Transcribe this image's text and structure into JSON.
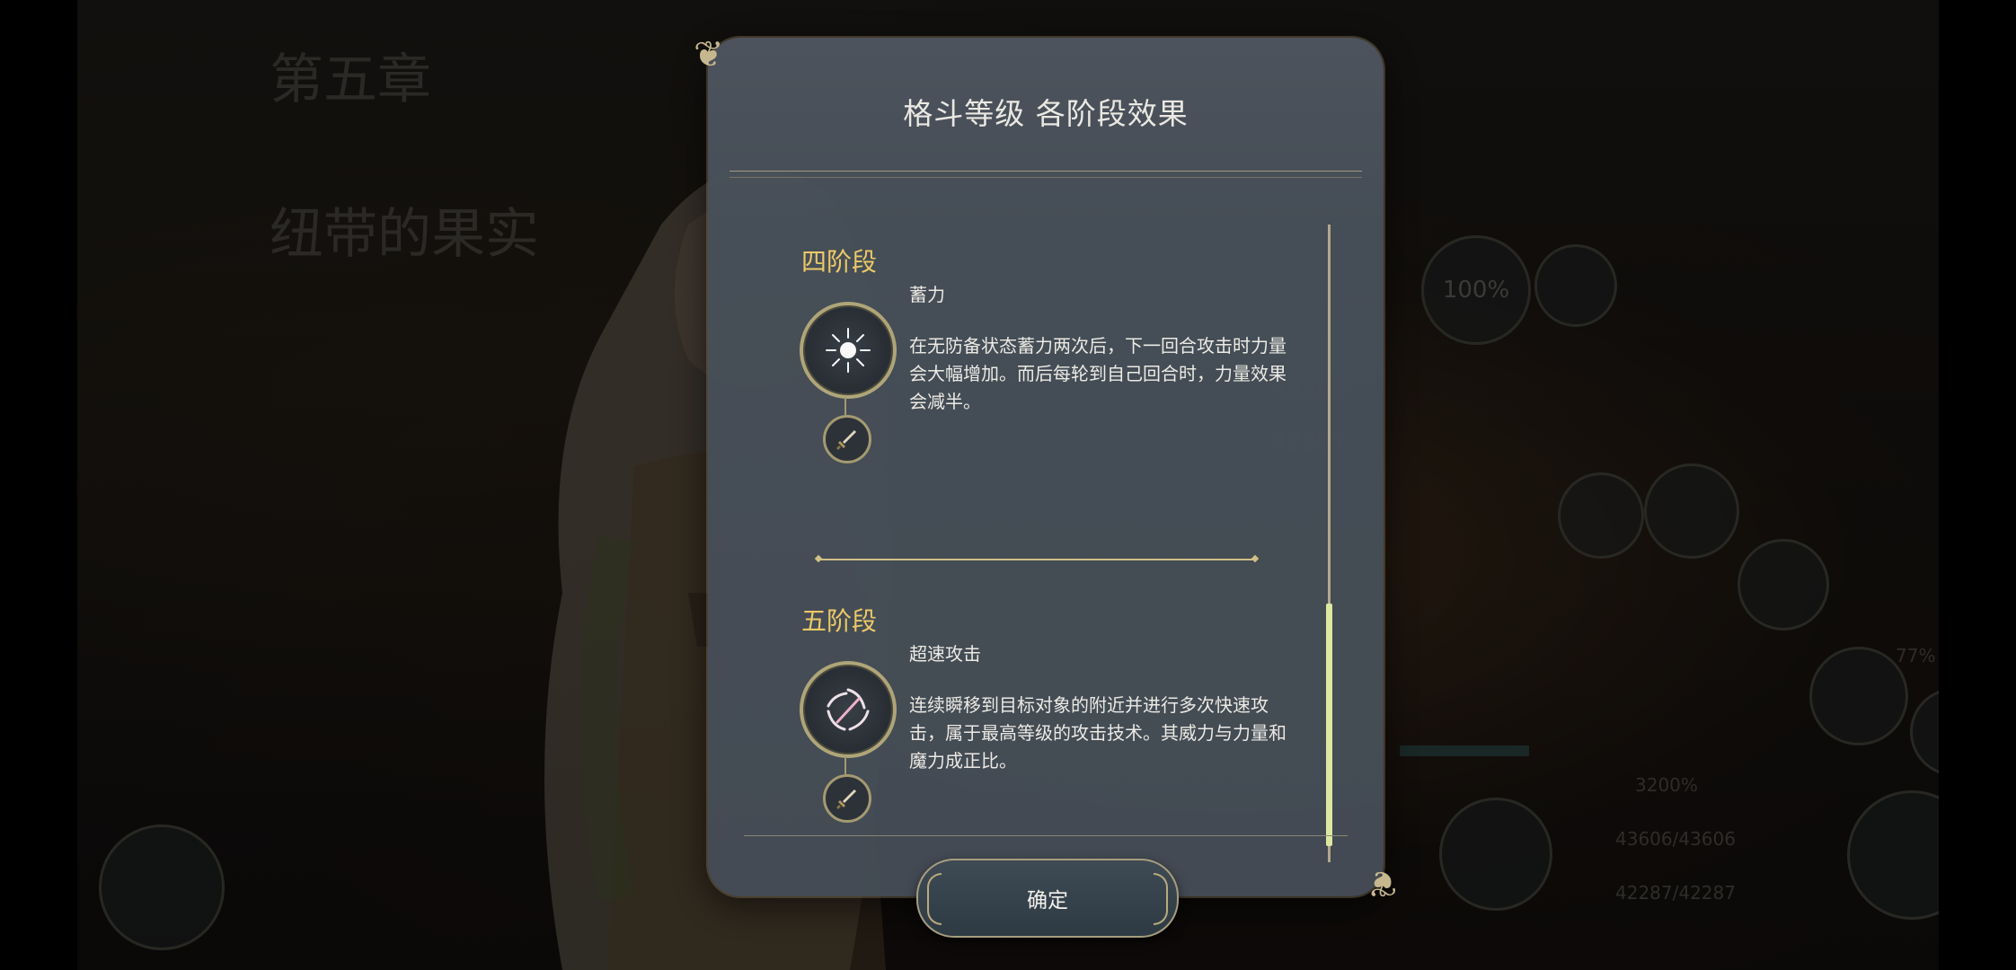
{
  "background": {
    "chapter": "第五章",
    "chapter_title": "纽带的果实",
    "percent_top": "100%",
    "percent_small": "77%",
    "percent_bar": "3200%",
    "hp": "43606/43606",
    "mp": "42287/42287"
  },
  "dialog": {
    "title": "格斗等级 各阶段效果",
    "stages": [
      {
        "label": "四阶段",
        "skill_icon": "burst-spark-icon",
        "weapon_icon": "sword-icon",
        "skill_name": "蓄力",
        "description": "在无防备状态蓄力两次后，下一回合攻击时力量会大幅增加。而后每轮到自己回合时，力量效果会减半。"
      },
      {
        "label": "五阶段",
        "skill_icon": "spiral-slash-icon",
        "weapon_icon": "sword-icon",
        "skill_name": "超速攻击",
        "description": "连续瞬移到目标对象的附近并进行多次快速攻击，属于最高等级的攻击技术。其威力与力量和魔力成正比。"
      }
    ],
    "confirm_label": "确定"
  },
  "colors": {
    "stage_label": "#f2cf69",
    "dialog_bg": "#4a525b",
    "scroll_thumb": "#e3f0a6",
    "accent_gold": "#b3a97c"
  }
}
